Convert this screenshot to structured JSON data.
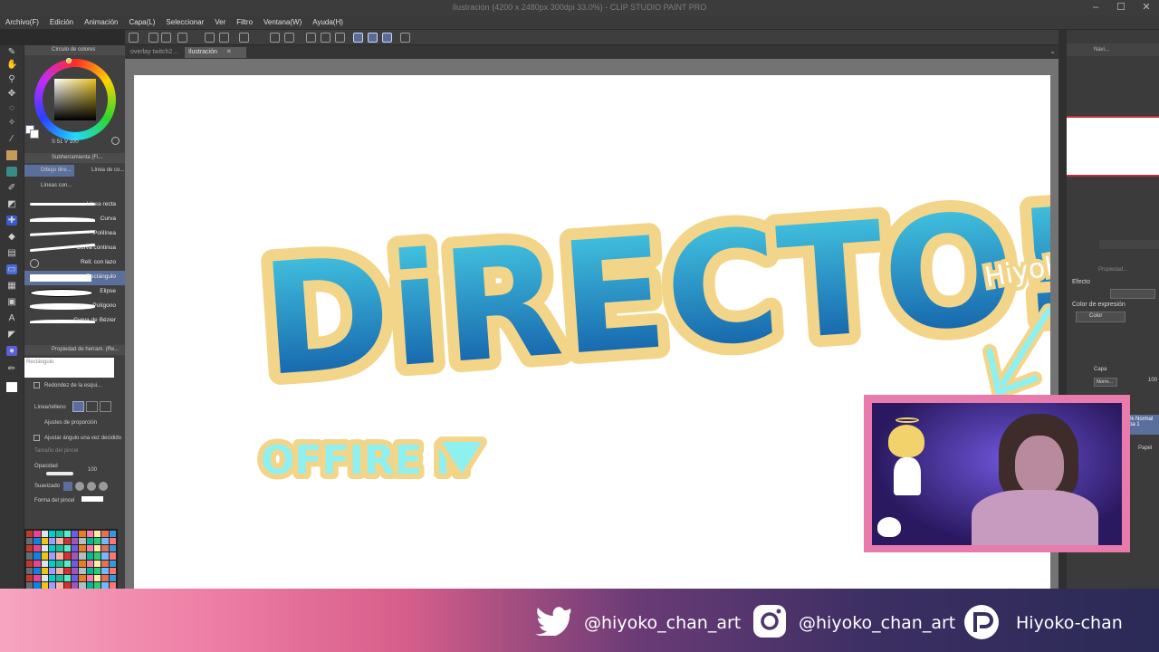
{
  "window": {
    "title": "Ilustración (4200 x 2480px 300dpi 33.0%) - CLIP STUDIO PAINT PRO"
  },
  "menu": [
    "Archivo(F)",
    "Edición",
    "Animación",
    "Capa(L)",
    "Seleccionar",
    "Ver",
    "Filtro",
    "Ventana(W)",
    "Ayuda(H)"
  ],
  "tabs": [
    {
      "label": "overlay twitch2...",
      "active": false
    },
    {
      "label": "Ilustración",
      "active": true
    }
  ],
  "color_panel": {
    "title": "Círculo de colores",
    "readout": "S 51  V 100"
  },
  "subtool_panel": {
    "title": "Subherramienta (Fi...",
    "tab_active": "Dibujo dire...",
    "tab_other": "Línea de co...",
    "group": "Líneas con...",
    "items": [
      {
        "label": "Línea recta",
        "selected": false
      },
      {
        "label": "Curva",
        "selected": false
      },
      {
        "label": "Polilínea",
        "selected": false
      },
      {
        "label": "Curva continua",
        "selected": false
      },
      {
        "label": "Rell. con lazo",
        "selected": false
      },
      {
        "label": "Rectángulo",
        "selected": true
      },
      {
        "label": "Elipse",
        "selected": false
      },
      {
        "label": "Polígono",
        "selected": false
      },
      {
        "label": "Curva de Bézier",
        "selected": false
      }
    ]
  },
  "tool_property": {
    "title": "Propiedad de herram. (Re...",
    "preview_label": "Rectángulo",
    "rounded_label": "Redondez de la esqui...",
    "line_fill_label": "Línea/relleno",
    "aspect_label": "Ajustes de proporción",
    "angle_label": "Ajustar ángulo una vez decidido",
    "brush_size_label": "Tamaño del pincel",
    "opacity_label": "Opacidad",
    "opacity_value": "100",
    "smoothing_label": "Suavizado",
    "brush_shape_label": "Forma del pincel"
  },
  "right_panel": {
    "nav_label": "Navi...",
    "property_label": "Propiedad...",
    "effect_label": "Efecto",
    "expr_color_label": "Color de expresión",
    "expr_color_value": "Color",
    "layer_label": "Capa",
    "blend_label": "Norm...",
    "opacity_value": "100",
    "layer_item": "% Normal",
    "layer_item2": "pa 1",
    "paper_label": "Papel"
  },
  "canvas": {
    "headline": "DiRECTO!",
    "subtitle": "OFFIRE N",
    "handwritten": "HiyoKo",
    "headline_color_top": "#4ad3e8",
    "headline_color_bottom": "#0b4fa0",
    "outline_color": "#f3d58a"
  },
  "banner": {
    "twitter": "@hiyoko_chan_art",
    "instagram": "@hiyoko_chan_art",
    "picarto": "Hiyoko-chan"
  },
  "colors": {
    "ui_dark": "#404040",
    "accent_blue": "#5b6f9c",
    "webcam_frame": "#e87bab"
  }
}
